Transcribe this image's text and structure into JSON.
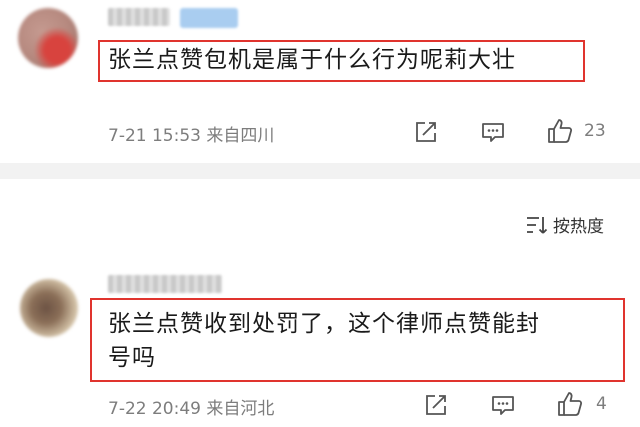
{
  "comments": [
    {
      "text": "张兰点赞包机是属于什么行为呢莉大壮",
      "meta": "7-21 15:53  来自四川",
      "likes": "23"
    },
    {
      "text_line1": "张兰点赞收到处罚了，这个律师点赞能封",
      "text_line2": "号吗",
      "meta": "7-22 20:49  来自河北",
      "likes": "4"
    }
  ],
  "sort": {
    "label": "按热度",
    "icon": "sort-icon"
  },
  "icons": {
    "share": "share-icon",
    "comment": "comment-icon",
    "like": "thumbs-up-icon"
  },
  "colors": {
    "highlight": "#e0342e",
    "meta_text": "#7d7d7d",
    "divider": "#f2f2f2"
  }
}
